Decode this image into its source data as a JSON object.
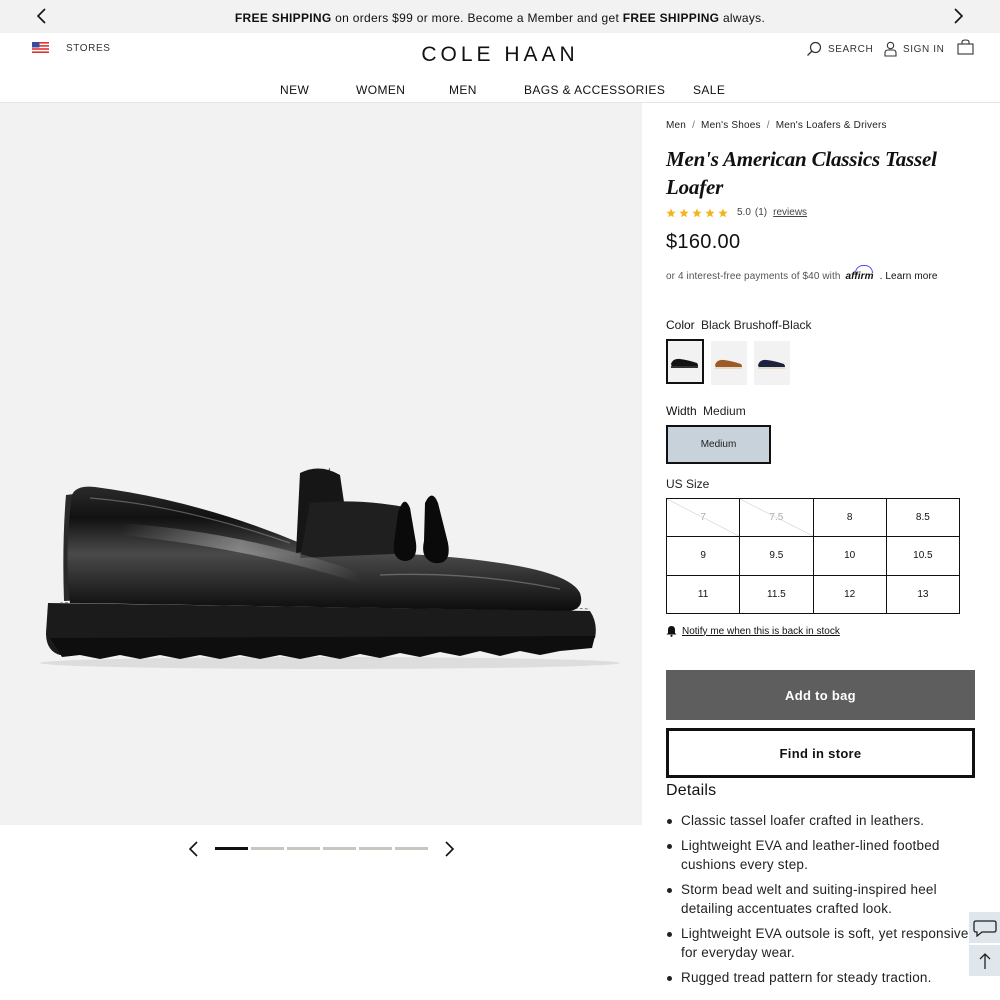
{
  "promo": {
    "bold1": "FREE SHIPPING",
    "text1": " on orders $99 or more. Become a Member and get ",
    "bold2": "FREE SHIPPING",
    "text2": " always.",
    "prev_icon": "chevron-left-icon",
    "next_icon": "chevron-right-icon"
  },
  "header": {
    "stores_label": "STORES",
    "logo": "COLE HAAN",
    "search_label": "SEARCH",
    "signin_label": "SIGN IN"
  },
  "nav": {
    "items": [
      "NEW",
      "WOMEN",
      "MEN",
      "BAGS & ACCESSORIES",
      "SALE"
    ]
  },
  "gallery": {
    "slide_count": 6,
    "active_slide": 1
  },
  "product": {
    "breadcrumbs": [
      "Men",
      "Men's Shoes",
      "Men's Loafers & Drivers"
    ],
    "title": "Men's American Classics Tassel Loafer",
    "rating": "5.0",
    "rating_count": "(1)",
    "reviews_label": "reviews",
    "stars": 5,
    "price": "$160.00",
    "affirm_text": "or 4 interest-free payments of $40 with",
    "affirm_logo": "affirm",
    "affirm_learn": ". Learn more",
    "color_label": "Color",
    "color_value": "Black Brushoff-Black",
    "swatches": [
      "Black Brushoff-Black",
      "Tan",
      "Navy"
    ],
    "width_label": "Width",
    "width_value": "Medium",
    "width_option": "Medium",
    "size_label": "US Size",
    "sizes": [
      {
        "size": "7",
        "available": false
      },
      {
        "size": "7.5",
        "available": false
      },
      {
        "size": "8",
        "available": true
      },
      {
        "size": "8.5",
        "available": true
      },
      {
        "size": "9",
        "available": true
      },
      {
        "size": "9.5",
        "available": true
      },
      {
        "size": "10",
        "available": true
      },
      {
        "size": "10.5",
        "available": true
      },
      {
        "size": "11",
        "available": true
      },
      {
        "size": "11.5",
        "available": true
      },
      {
        "size": "12",
        "available": true
      },
      {
        "size": "13",
        "available": true
      }
    ],
    "notify_label": "Notify me when this is back in stock",
    "add_to_bag": "Add to bag",
    "find_in_store": "Find in store",
    "details_heading": "Details",
    "details": [
      "Classic tassel loafer crafted in leathers.",
      "Lightweight EVA and leather-lined footbed cushions every step.",
      "Storm bead welt and suiting-inspired heel detailing accentuates crafted look.",
      "Lightweight EVA outsole is soft, yet responsive for everyday wear.",
      "Rugged tread pattern for steady traction."
    ]
  },
  "colors": {
    "accent_button": "#5e5e5e",
    "width_selected": "#c8d2da",
    "star": "#f2b51b",
    "gallery_bg": "#f2f2f2"
  }
}
